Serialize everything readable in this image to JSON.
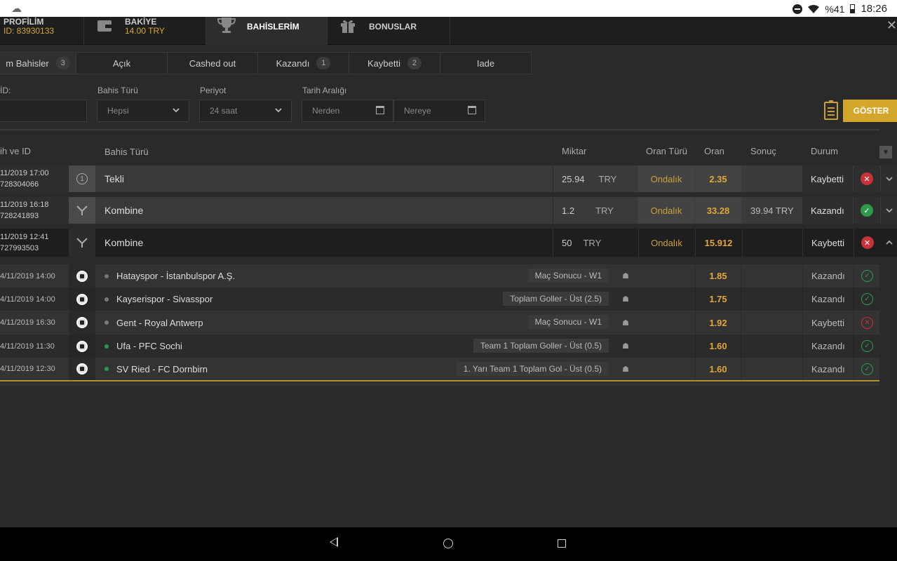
{
  "status": {
    "battery": "%41",
    "time": "18:26"
  },
  "header": {
    "tabs": [
      {
        "title": "PROFİLİM",
        "sub": "ID: 83930133"
      },
      {
        "title": "BAKİYE",
        "sub": "14.00 TRY"
      },
      {
        "title": "BAHİSLERİM",
        "sub": ""
      },
      {
        "title": "BONUSLAR",
        "sub": ""
      }
    ],
    "close": "✕"
  },
  "filter_tabs": [
    {
      "label": "m Bahisler",
      "count": "3"
    },
    {
      "label": "Açık",
      "count": ""
    },
    {
      "label": "Cashed out",
      "count": ""
    },
    {
      "label": "Kazandı",
      "count": "1"
    },
    {
      "label": "Kaybetti",
      "count": "2"
    },
    {
      "label": "Iade",
      "count": ""
    }
  ],
  "filters": {
    "id_label": "İD:",
    "bet_type_label": "Bahis Türü",
    "bet_type_value": "Hepsi",
    "period_label": "Periyot",
    "period_value": "24 saat",
    "date_label": "Tarih Aralığı",
    "from_placeholder": "Nerden",
    "to_placeholder": "Nereye",
    "show_button": "GÖSTER"
  },
  "columns": {
    "date_id": "ih ve ID",
    "bet_type": "Bahis Türü",
    "amount": "Miktar",
    "odds_type": "Oran Türü",
    "odds": "Oran",
    "result": "Sonuç",
    "status": "Durum"
  },
  "bets": [
    {
      "date": "11/2019 17:00",
      "id": "728304066",
      "type": "Tekli",
      "amount": "25.94",
      "currency": "TRY",
      "odds_type": "Ondalık",
      "odds": "2.35",
      "result": "",
      "status": "Kaybetti"
    },
    {
      "date": "11/2019 16:18",
      "id": "728241893",
      "type": "Kombine",
      "amount": "1.2",
      "currency": "TRY",
      "odds_type": "Ondalık",
      "odds": "33.28",
      "result": "39.94 TRY",
      "status": "Kazandı"
    },
    {
      "date": "11/2019 12:41",
      "id": "727993503",
      "type": "Kombine",
      "amount": "50",
      "currency": "TRY",
      "odds_type": "Ondalık",
      "odds": "15.912",
      "result": "",
      "status": "Kaybetti"
    }
  ],
  "selections": [
    {
      "date": "4/11/2019 14:00",
      "match": "Hatayspor - İstanbulspor A.Ş.",
      "market": "Maç Sonucu - W1",
      "odds": "1.85",
      "status": "Kazandı"
    },
    {
      "date": "4/11/2019 14:00",
      "match": "Kayserispor - Sivasspor",
      "market": "Toplam Goller - Üst (2.5)",
      "odds": "1.75",
      "status": "Kazandı"
    },
    {
      "date": "4/11/2019 16:30",
      "match": "Gent - Royal Antwerp",
      "market": "Maç Sonucu - W1",
      "odds": "1.92",
      "status": "Kaybetti"
    },
    {
      "date": "4/11/2019 11:30",
      "match": "Ufa - PFC Sochi",
      "market": "Team 1 Toplam Goller - Üst (0.5)",
      "odds": "1.60",
      "status": "Kazandı"
    },
    {
      "date": "4/11/2019 12:30",
      "match": "SV Ried - FC Dornbirn",
      "market": "1. Yarı Team 1 Toplam Gol - Üst (0.5)",
      "odds": "1.60",
      "status": "Kazandı"
    }
  ],
  "colors": {
    "accent": "#d4a72c",
    "win": "#2e9b4c",
    "loss": "#c8323a"
  }
}
